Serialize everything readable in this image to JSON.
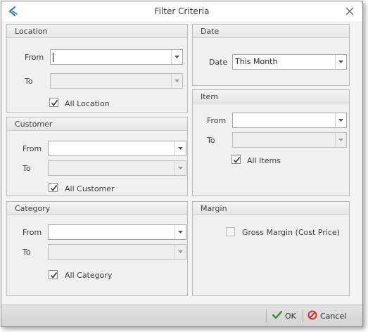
{
  "window": {
    "title": "Filter Criteria"
  },
  "location": {
    "header": "Location",
    "from_label": "From",
    "from_value": "",
    "to_label": "To",
    "to_value": "",
    "all_label": "All Location",
    "all_checked": true
  },
  "date": {
    "header": "Date",
    "date_label": "Date",
    "date_value": "This Month"
  },
  "customer": {
    "header": "Customer",
    "from_label": "From",
    "from_value": "",
    "to_label": "To",
    "to_value": "",
    "all_label": "All Customer",
    "all_checked": true
  },
  "item": {
    "header": "Item",
    "from_label": "From",
    "from_value": "",
    "to_label": "To",
    "to_value": "",
    "all_label": "All Items",
    "all_checked": true
  },
  "category": {
    "header": "Category",
    "from_label": "From",
    "from_value": "",
    "to_label": "To",
    "to_value": "",
    "all_label": "All Category",
    "all_checked": true
  },
  "margin": {
    "header": "Margin",
    "gross_label": "Gross Margin (Cost Price)",
    "gross_checked": false
  },
  "footer": {
    "ok_label": "OK",
    "cancel_label": "Cancel"
  },
  "colors": {
    "ok_check": "#3d8b2f",
    "cancel_icon": "#d9302a",
    "app_icon": "#2f6fb7"
  }
}
